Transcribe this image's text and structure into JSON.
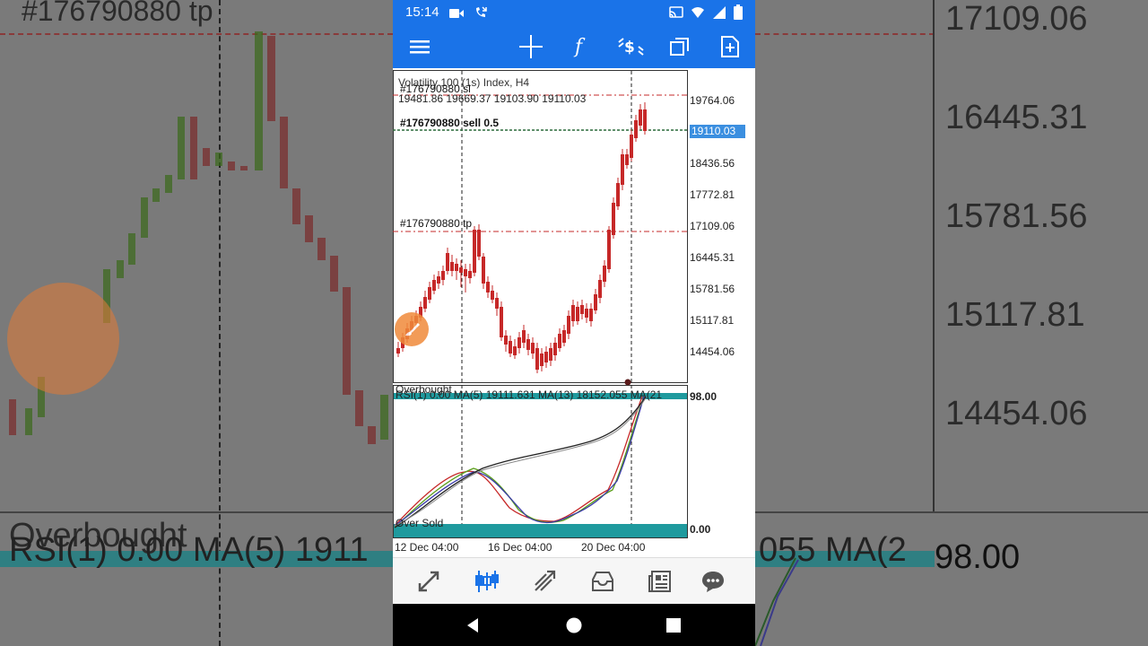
{
  "statusbar": {
    "time": "15:14"
  },
  "chart": {
    "title": "Volatility 100 (1s) Index, H4",
    "ohlc": "19481.86 19669.37 19103.90 19110.03",
    "sl_label": "#176790880 sl",
    "sell_label": "#176790880 sell 0.5",
    "tp_label": "#176790880 tp",
    "current_price": "19110.03",
    "price_ticks": [
      "19764.06",
      "18436.56",
      "17772.81",
      "17109.06",
      "16445.31",
      "15781.56",
      "15117.81",
      "14454.06"
    ],
    "rsi_header": "RSI(1) 0.00 MA(5) 19111.631 MA(13) 18152.055 MA(21",
    "overbought_label": "Overbought",
    "oversold_label": "Over Sold",
    "rsi_top_ticks": "98.00",
    "rsi_bottom_ticks": "0.00",
    "date_labels": [
      "12 Dec 04:00",
      "16 Dec 04:00",
      "20 Dec 04:00"
    ],
    "colors": {
      "bull": "#5a9e1a",
      "bear": "#c62828",
      "teal": "#1f9a9e",
      "sl_tp_line": "#c62828",
      "price_tag": "#3b8fe0"
    }
  },
  "background": {
    "tp_text": "#176790880 tp",
    "prices": [
      "17109.06",
      "16445.31",
      "15781.56",
      "15117.81",
      "14454.06"
    ],
    "overbought": "Overbought",
    "rsi_text": "RSI(1) 0.00 MA(5) 1911",
    "rsi_tail": "055 MA(2",
    "rsi_value": "98.00"
  },
  "icons": {
    "status": [
      "video-icon",
      "missed-call-icon",
      "cast-icon",
      "wifi-icon",
      "signal-icon",
      "battery-icon"
    ],
    "toolbar": [
      "menu-icon",
      "crosshair-icon",
      "function-icon",
      "trade-icon",
      "windows-icon",
      "new-order-icon"
    ],
    "bottom_nav": [
      "quotes-icon",
      "chart-icon",
      "trade-icon",
      "history-icon",
      "news-icon",
      "chat-icon"
    ],
    "system": [
      "back-icon",
      "home-icon",
      "recents-icon"
    ]
  }
}
